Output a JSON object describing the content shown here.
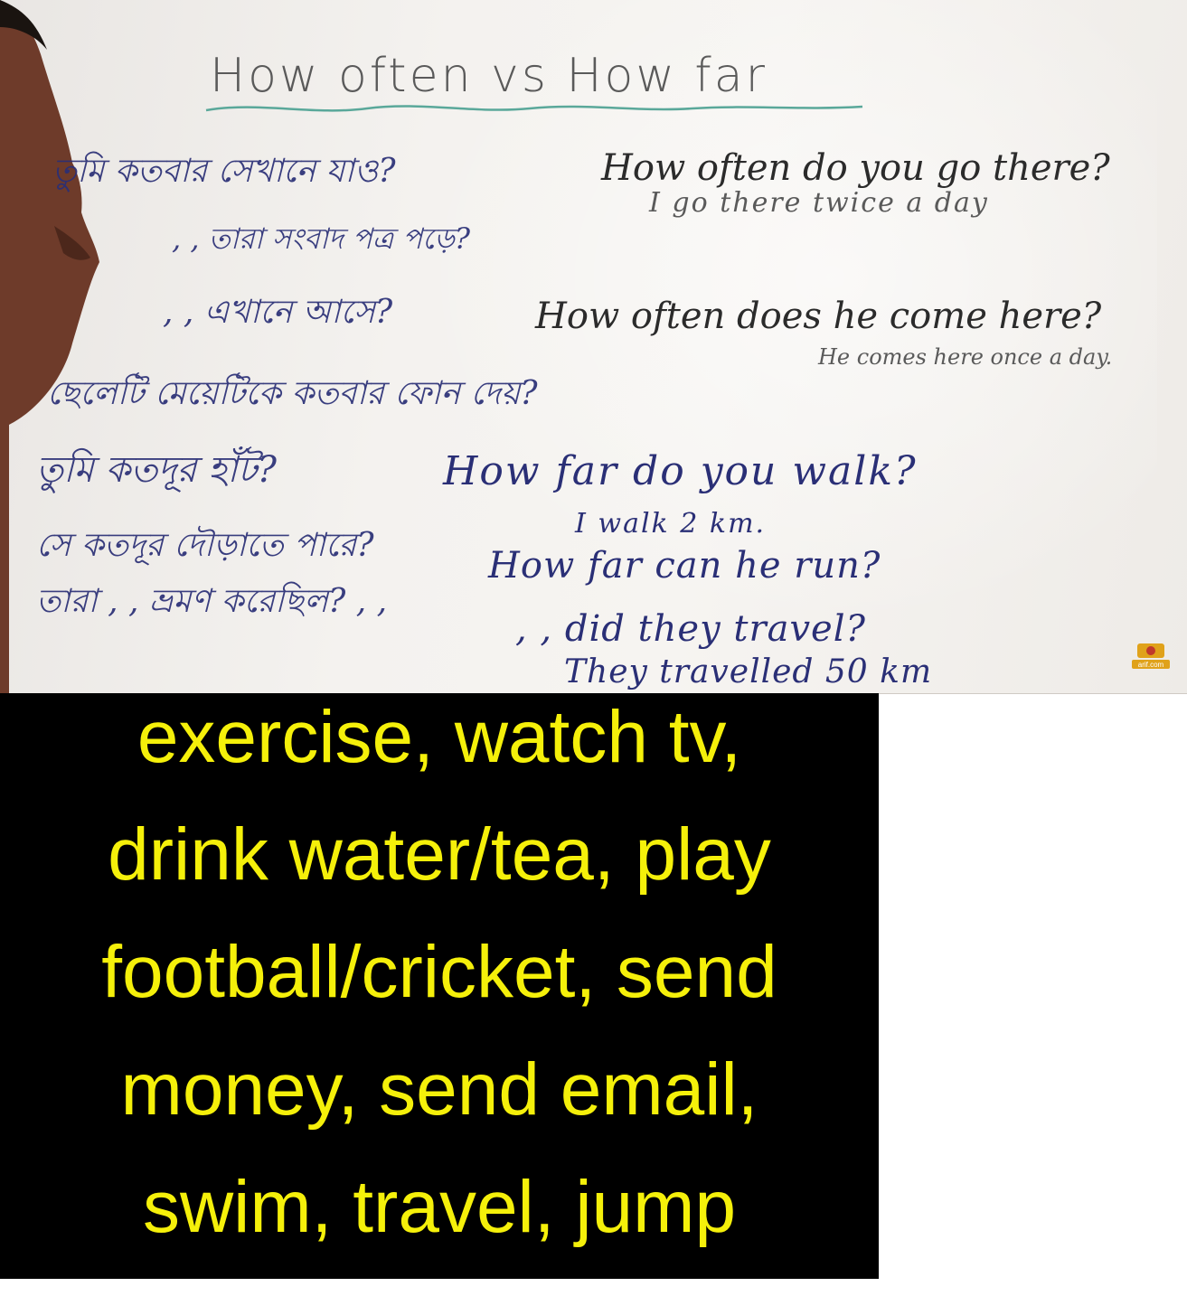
{
  "whiteboard": {
    "title": "How often vs How far",
    "lines": [
      {
        "id": "q-go-there",
        "text": "How often do you go there?"
      },
      {
        "id": "a-go-there",
        "text": "I go there twice a day"
      },
      {
        "id": "q-come-here",
        "text": "How often does he come here?"
      },
      {
        "id": "a-come-here",
        "text": "He comes here once a day."
      },
      {
        "id": "q-walk",
        "text": "How far do you walk?"
      },
      {
        "id": "a-walk",
        "text": "I walk 2 km."
      },
      {
        "id": "q-run",
        "text": "How far can he run?"
      },
      {
        "id": "q-travel",
        "text": ", , did they travel?"
      },
      {
        "id": "a-travel",
        "text": "They travelled 50 km"
      }
    ],
    "bengali_lines": [
      {
        "id": "bn-1",
        "text": "তুমি কতবার সেখানে যাও?"
      },
      {
        "id": "bn-2",
        "text": ", , তারা সংবাদ পত্র পড়ে?"
      },
      {
        "id": "bn-3",
        "text": ", , এখানে আসে?"
      },
      {
        "id": "bn-4",
        "text": "ছেলেটি মেয়েটিকে কতবার ফোন দেয়?"
      },
      {
        "id": "bn-5",
        "text": "তুমি কতদূর হাঁট?"
      },
      {
        "id": "bn-6",
        "text": "সে কতদূর দৌড়াতে পারে?"
      },
      {
        "id": "bn-7",
        "text": "তারা , , ভ্রমণ করেছিল? , ,"
      }
    ],
    "logo_text": "arif.com"
  },
  "caption": {
    "lines": [
      "exercise, watch tv,",
      "drink water/tea, play",
      "football/cricket, send",
      "money, send email,",
      "swim, travel, jump"
    ]
  },
  "colors": {
    "caption_background": "#000000",
    "caption_text": "#f5f00a",
    "ink_gray": "#5a5a5a",
    "ink_blue": "#2a2f76",
    "underline_green": "#5aa89a"
  }
}
